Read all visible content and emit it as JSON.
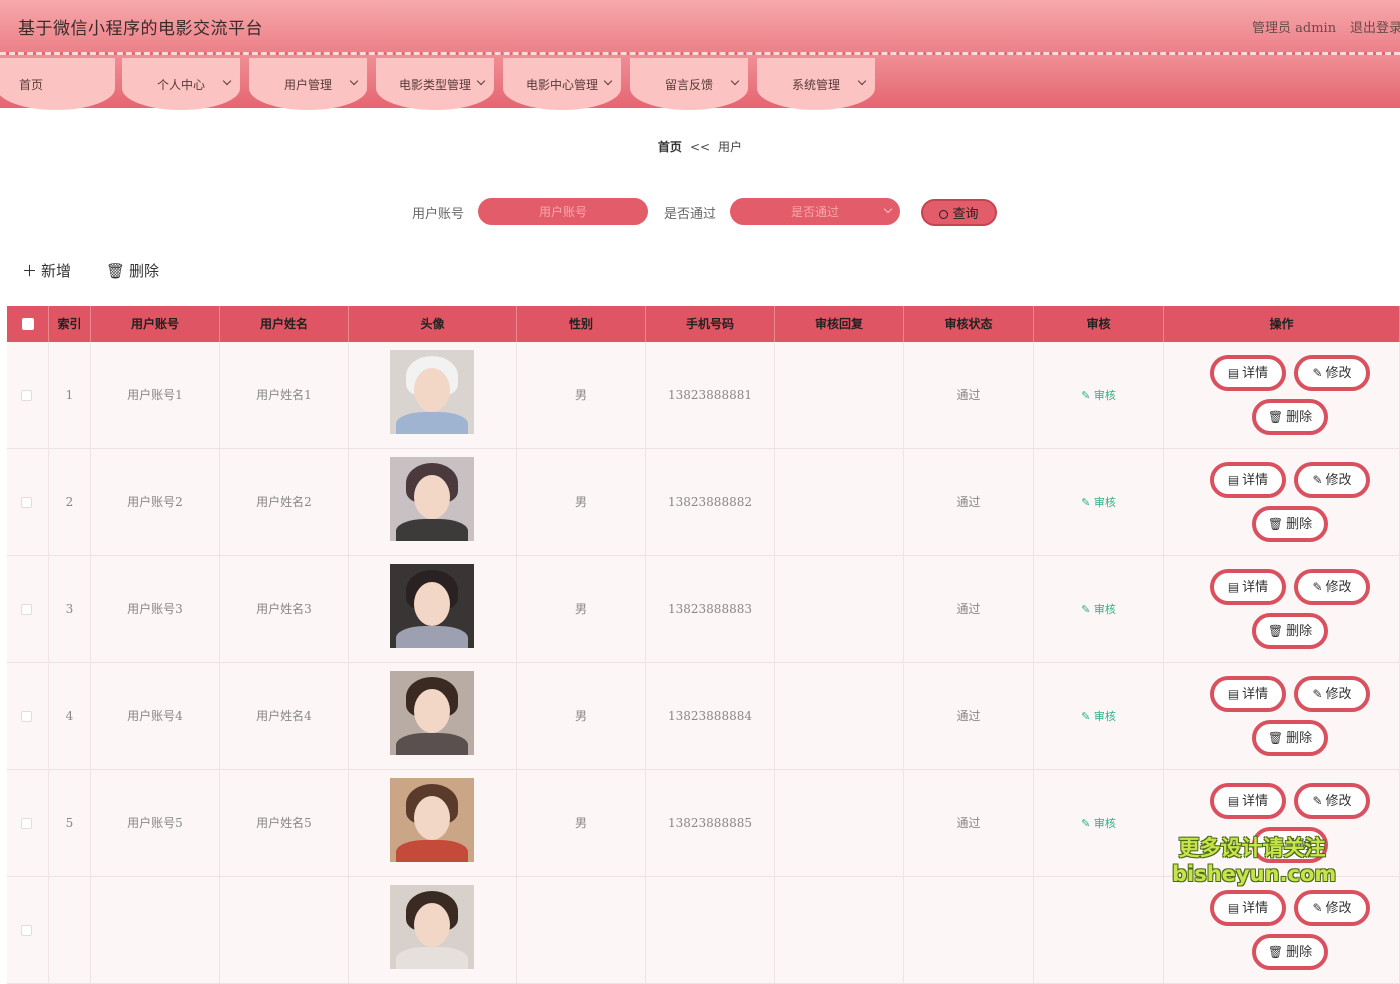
{
  "header": {
    "title": "基于微信小程序的电影交流平台",
    "admin": "管理员 admin",
    "logout": "退出登录"
  },
  "nav": [
    {
      "label": "首页",
      "has_dropdown": false
    },
    {
      "label": "个人中心",
      "has_dropdown": true
    },
    {
      "label": "用户管理",
      "has_dropdown": true
    },
    {
      "label": "电影类型管理",
      "has_dropdown": true
    },
    {
      "label": "电影中心管理",
      "has_dropdown": true
    },
    {
      "label": "留言反馈",
      "has_dropdown": true
    },
    {
      "label": "系统管理",
      "has_dropdown": true
    }
  ],
  "breadcrumb": {
    "home": "首页",
    "sep": "<<",
    "current": "用户"
  },
  "search": {
    "account_label": "用户账号",
    "account_placeholder": "用户账号",
    "pass_label": "是否通过",
    "pass_placeholder": "是否通过",
    "query_label": "查询"
  },
  "toolbar": {
    "add_label": "新增",
    "delete_label": "删除"
  },
  "table": {
    "columns": [
      "索引",
      "用户账号",
      "用户姓名",
      "头像",
      "性别",
      "手机号码",
      "审核回复",
      "审核状态",
      "审核",
      "操作"
    ],
    "audit_link": "审核",
    "buttons": {
      "detail": "详情",
      "edit": "修改",
      "delete": "删除"
    },
    "rows": [
      {
        "index": "1",
        "account": "用户账号1",
        "name": "用户姓名1",
        "gender": "男",
        "phone": "13823888881",
        "reply": "",
        "status": "通过"
      },
      {
        "index": "2",
        "account": "用户账号2",
        "name": "用户姓名2",
        "gender": "男",
        "phone": "13823888882",
        "reply": "",
        "status": "通过"
      },
      {
        "index": "3",
        "account": "用户账号3",
        "name": "用户姓名3",
        "gender": "男",
        "phone": "13823888883",
        "reply": "",
        "status": "通过"
      },
      {
        "index": "4",
        "account": "用户账号4",
        "name": "用户姓名4",
        "gender": "男",
        "phone": "13823888884",
        "reply": "",
        "status": "通过"
      },
      {
        "index": "5",
        "account": "用户账号5",
        "name": "用户姓名5",
        "gender": "男",
        "phone": "13823888885",
        "reply": "",
        "status": "通过"
      },
      {
        "index": "",
        "account": "",
        "name": "",
        "gender": "",
        "phone": "",
        "reply": "",
        "status": ""
      }
    ]
  },
  "watermark": {
    "line1": "更多设计请关注",
    "line2": "bisheyun.com"
  },
  "colors": {
    "accent": "#e05563",
    "header": "#ec8088",
    "nav_tab": "#fbc3c1",
    "audit": "#2fb08a"
  }
}
